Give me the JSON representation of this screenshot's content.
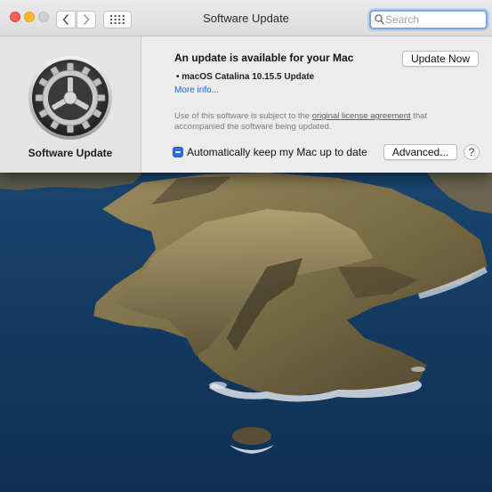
{
  "window": {
    "title": "Software Update",
    "search_placeholder": "Search"
  },
  "sidebar": {
    "icon": "gear-icon",
    "label": "Software Update"
  },
  "main": {
    "headline": "An update is available for your Mac",
    "update_item": "• macOS Catalina 10.15.5 Update",
    "more_info_link": "More info...",
    "update_now_button": "Update Now",
    "license_text_before": "Use of this software is subject to the ",
    "license_link": "original license agreement",
    "license_text_after": " that accompanied the software being updated.",
    "auto_update_checked": true,
    "auto_update_label": "Automatically keep my Mac up to date",
    "advanced_button": "Advanced...",
    "help_button": "?"
  },
  "colors": {
    "close": "#fe5f57",
    "minimize": "#febc2e",
    "link": "#1a64d6",
    "checkbox": "#2e6fe0"
  }
}
